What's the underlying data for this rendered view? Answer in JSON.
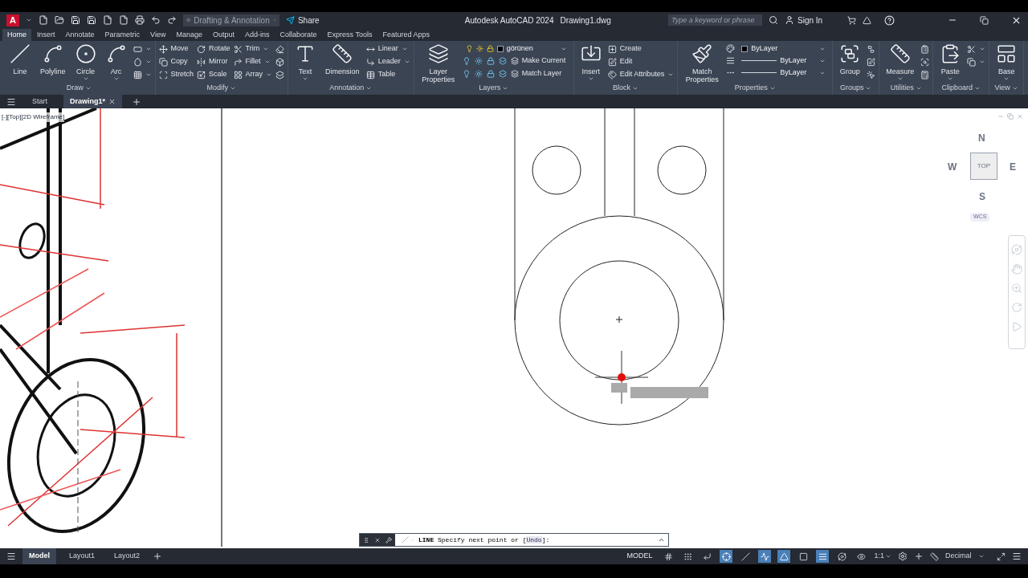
{
  "title_bar": {
    "logo": "A",
    "workspace": "Drafting & Annotation",
    "share": "Share",
    "app_name": "Autodesk AutoCAD 2024",
    "file_name": "Drawing1.dwg",
    "search": {
      "placeholder": "Type a keyword or phrase"
    },
    "sign_in": "Sign In"
  },
  "ribbon_tabs": [
    {
      "label": "Home",
      "selected": true
    },
    {
      "label": "Insert",
      "selected": false
    },
    {
      "label": "Annotate",
      "selected": false
    },
    {
      "label": "Parametric",
      "selected": false
    },
    {
      "label": "View",
      "selected": false
    },
    {
      "label": "Manage",
      "selected": false
    },
    {
      "label": "Output",
      "selected": false
    },
    {
      "label": "Add-ins",
      "selected": false
    },
    {
      "label": "Collaborate",
      "selected": false
    },
    {
      "label": "Express Tools",
      "selected": false
    },
    {
      "label": "Featured Apps",
      "selected": false
    }
  ],
  "ribbon_panels": [
    {
      "kind": "tools",
      "title": "Draw",
      "large": [
        {
          "label": "Line",
          "caret": false
        },
        {
          "label": "Polyline",
          "caret": false
        },
        {
          "label": "Circle",
          "caret": true
        },
        {
          "label": "Arc",
          "caret": true
        }
      ],
      "small": [
        {
          "caret": true
        },
        {
          "caret": true
        },
        {
          "caret": true
        }
      ]
    },
    {
      "kind": "tools",
      "title": "Modify",
      "small": [
        {
          "label": "Move",
          "caret": false
        },
        {
          "label": "Copy",
          "caret": false
        },
        {
          "label": "Stretch",
          "caret": false
        },
        {
          "label": "Rotate",
          "caret": false
        },
        {
          "label": "Mirror",
          "caret": false
        },
        {
          "label": "Scale",
          "caret": false
        },
        {
          "label": "Trim",
          "caret": true
        },
        {
          "label": "Fillet",
          "caret": true
        },
        {
          "label": "Array",
          "caret": true
        },
        {
          "caret": false
        },
        {
          "caret": false
        },
        {
          "caret": false
        }
      ]
    },
    {
      "kind": "tools",
      "title": "Annotation",
      "large": [
        {
          "label": "Text",
          "caret": true
        },
        {
          "label": "Dimension",
          "caret": false
        }
      ],
      "small": [
        {
          "label": "Linear",
          "caret": true
        },
        {
          "label": "Leader",
          "caret": true
        },
        {
          "label": "Table",
          "caret": false
        }
      ]
    },
    {
      "kind": "layers",
      "title": "Layers",
      "large": [
        {
          "label": "Layer Properties",
          "caret": false
        }
      ],
      "layer": "görünen",
      "actions": [
        "Make Current",
        "Match Layer"
      ]
    },
    {
      "kind": "tools",
      "title": "Block",
      "large": [
        {
          "label": "Insert",
          "caret": true
        }
      ],
      "small": [
        {
          "label": "Create",
          "caret": false
        },
        {
          "label": "Edit",
          "caret": false
        },
        {
          "label": "Edit Attributes",
          "caret": true
        }
      ]
    },
    {
      "kind": "properties",
      "title": "Properties",
      "large": [
        {
          "label": "Match Properties",
          "caret": false
        }
      ],
      "fields": [
        {
          "kind": "color",
          "value": "ByLayer"
        },
        {
          "kind": "lineweight",
          "value": "ByLayer"
        },
        {
          "kind": "linetype",
          "value": "ByLayer"
        }
      ]
    },
    {
      "kind": "tools",
      "title": "Groups",
      "large": [
        {
          "label": "Group",
          "caret": false
        }
      ],
      "small": [
        {
          "caret": false
        },
        {
          "caret": false
        },
        {
          "caret": false
        }
      ]
    },
    {
      "kind": "tools",
      "title": "Utilities",
      "large": [
        {
          "label": "Measure",
          "caret": true
        }
      ],
      "small": [
        {
          "caret": false
        },
        {
          "caret": false
        },
        {
          "caret": false
        }
      ]
    },
    {
      "kind": "tools",
      "title": "Clipboard",
      "large": [
        {
          "label": "Paste",
          "caret": true
        }
      ],
      "small": [
        {
          "caret": true
        },
        {
          "caret": true
        }
      ]
    },
    {
      "kind": "tools",
      "title": "View",
      "large": [
        {
          "label": "Base",
          "caret": true
        }
      ]
    }
  ],
  "document_tabs": [
    {
      "label": "Start",
      "selected": false,
      "closable": false
    },
    {
      "label": "Drawing1*",
      "selected": true,
      "closable": true
    }
  ],
  "viewport_label": "[-][Top][2D Wireframe]",
  "viewcube": {
    "north": "N",
    "west": "W",
    "face": "TOP",
    "east": "E",
    "south": "S",
    "ucs": "WCS"
  },
  "command_line": {
    "command": "LINE",
    "prompt": "Specify next point or [",
    "option": "Undo",
    "prompt_end": "]:"
  },
  "layout_tabs": [
    {
      "label": "Model",
      "selected": true
    },
    {
      "label": "Layout1",
      "selected": false
    },
    {
      "label": "Layout2",
      "selected": false
    }
  ],
  "status_bar": {
    "space": "MODEL",
    "toggles": [
      {
        "on": false
      },
      {
        "on": false
      },
      {
        "on": false
      },
      {
        "on": true
      },
      {
        "on": false
      },
      {
        "on": true
      },
      {
        "on": true
      },
      {
        "on": false
      },
      {
        "on": true
      },
      {
        "on": false
      },
      {
        "on": false
      }
    ],
    "scale": "1:1",
    "units": "Decimal"
  }
}
